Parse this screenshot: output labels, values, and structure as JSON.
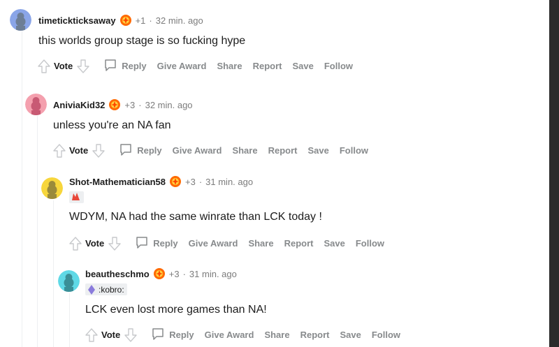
{
  "colors": {
    "text": "#1c1c1c",
    "muted": "#7c7c7c",
    "action": "#878a8c",
    "thread_line": "#edeff1"
  },
  "comments": [
    {
      "username": "timetickticksaway",
      "award_icon": "award-icon",
      "awards": "+1",
      "time": "32 min. ago",
      "body": "this worlds group stage is so fucking hype",
      "avatar_color": "#8aa5e8",
      "actions": {
        "vote": "Vote",
        "reply": "Reply",
        "give_award": "Give Award",
        "share": "Share",
        "report": "Report",
        "save": "Save",
        "follow": "Follow"
      }
    },
    {
      "username": "AniviaKid32",
      "award_icon": "award-icon",
      "awards": "+3",
      "time": "32 min. ago",
      "body": "unless you're an NA fan",
      "avatar_color": "#f4a0ae",
      "actions": {
        "vote": "Vote",
        "reply": "Reply",
        "give_award": "Give Award",
        "share": "Share",
        "report": "Report",
        "save": "Save",
        "follow": "Follow"
      }
    },
    {
      "username": "Shot-Mathematician58",
      "award_icon": "award-icon",
      "awards": "+3",
      "time": "31 min. ago",
      "flair_icon": "team-logo-icon",
      "body": "WDYM, NA had the same winrate than LCK today !",
      "avatar_color": "#f7d63c",
      "actions": {
        "vote": "Vote",
        "reply": "Reply",
        "give_award": "Give Award",
        "share": "Share",
        "report": "Report",
        "save": "Save",
        "follow": "Follow"
      }
    },
    {
      "username": "beautheschmo",
      "award_icon": "award-icon",
      "awards": "+3",
      "time": "31 min. ago",
      "flair_icon": "crystal-icon",
      "flair": ":kobro:",
      "body": "LCK even lost more games than NA!",
      "avatar_color": "#5fd9e6",
      "actions": {
        "vote": "Vote",
        "reply": "Reply",
        "give_award": "Give Award",
        "share": "Share",
        "report": "Report",
        "save": "Save",
        "follow": "Follow"
      }
    }
  ],
  "separator": "·"
}
